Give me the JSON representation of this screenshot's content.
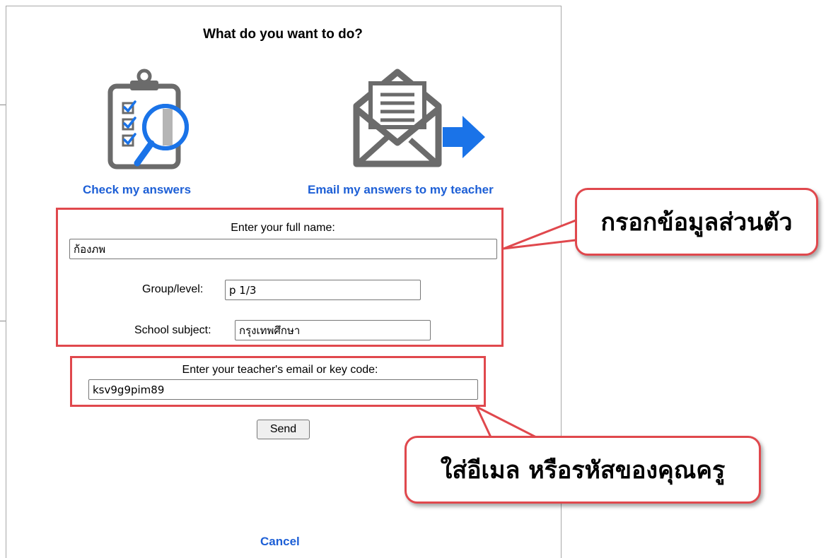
{
  "dialog": {
    "title": "What do you want to do?",
    "check_option": {
      "icon": "clipboard-checklist-icon",
      "label": "Check my answers"
    },
    "email_option": {
      "icon": "envelope-send-icon",
      "label": "Email my answers to my teacher"
    }
  },
  "form": {
    "full_name_label": "Enter your full name:",
    "full_name_value": "ก้องภพ",
    "group_label": "Group/level:",
    "group_value": "p 1/3",
    "subject_label": "School subject:",
    "subject_value": "กรุงเทพศึกษา",
    "teacher_label": "Enter your teacher's email or key code:",
    "teacher_value": "ksv9g9pim89",
    "send_label": "Send",
    "cancel_label": "Cancel"
  },
  "annotations": {
    "personal_info": "กรอกข้อมูลส่วนตัว",
    "teacher_email": "ใส่อีเมล หรือรหัสของคุณครู"
  },
  "colors": {
    "link": "#1d5fd6",
    "highlight": "#e0484d",
    "icon_gray": "#6b6b6b",
    "icon_blue": "#1a73e8"
  }
}
